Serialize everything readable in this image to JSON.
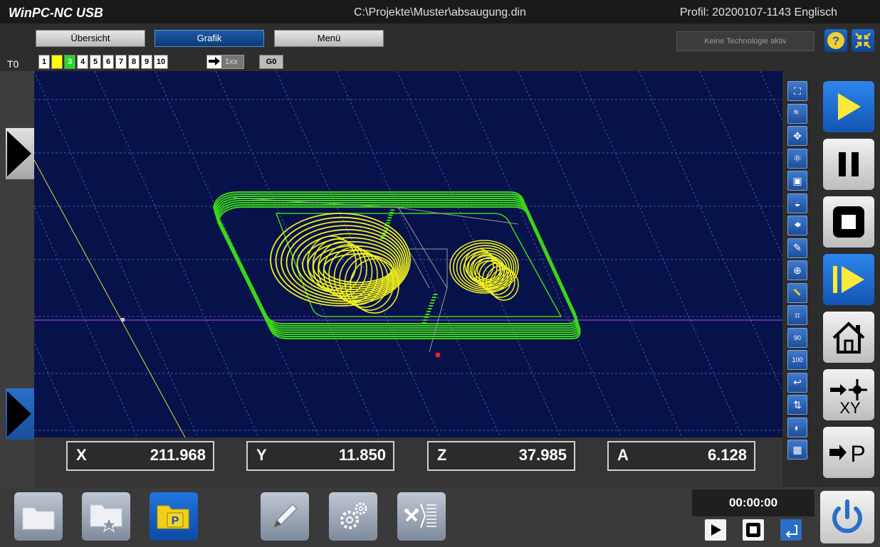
{
  "title_bar": {
    "app_title": "WinPC-NC USB",
    "file_path": "C:\\Projekte\\Muster\\absaugung.din",
    "profile": "Profil: 20200107-1143 Englisch"
  },
  "tabs": [
    {
      "label": "Übersicht",
      "active": false
    },
    {
      "label": "Grafik",
      "active": true
    },
    {
      "label": "Menü",
      "active": false
    }
  ],
  "technology_status": "Keine Technologie aktiv",
  "tools": {
    "current_tool": "T0",
    "tool_numbers": [
      "1",
      "2",
      "3",
      "4",
      "5",
      "6",
      "7",
      "8",
      "9",
      "10"
    ],
    "highlighted": {
      "2": "#ffff00",
      "3": "#22dd22"
    },
    "mode_1xx": "1xx",
    "mode_g0": "G0"
  },
  "coordinates": [
    {
      "axis": "X",
      "value": "211.968"
    },
    {
      "axis": "Y",
      "value": "11.850"
    },
    {
      "axis": "Z",
      "value": "37.985"
    },
    {
      "axis": "A",
      "value": "6.128"
    }
  ],
  "timer": "00:00:00",
  "small_tools": [
    {
      "name": "zoom-fit-icon",
      "glyph": "⛶"
    },
    {
      "name": "zoom-icon",
      "glyph": "🔍"
    },
    {
      "name": "pan-icon",
      "glyph": "✥"
    },
    {
      "name": "atom-icon",
      "glyph": "⚛"
    },
    {
      "name": "cube-view-icon",
      "glyph": "▣"
    },
    {
      "name": "glasses-icon",
      "glyph": "◒"
    },
    {
      "name": "back-arrow-icon",
      "glyph": "🡄"
    },
    {
      "name": "pin-icon",
      "glyph": "✎"
    },
    {
      "name": "move-crosshair-icon",
      "glyph": "⊕"
    },
    {
      "name": "ruler-icon",
      "glyph": "📏"
    },
    {
      "name": "frame-icon",
      "glyph": "⌗"
    },
    {
      "name": "rotate-90-icon",
      "glyph": "90"
    },
    {
      "name": "move-100-icon",
      "glyph": "100"
    },
    {
      "name": "return-icon",
      "glyph": "↩"
    },
    {
      "name": "swap-arrows-icon",
      "glyph": "⇅"
    },
    {
      "name": "contrast-icon",
      "glyph": "◐"
    },
    {
      "name": "grid-icon",
      "glyph": "▦"
    }
  ],
  "big_tools": [
    {
      "name": "start-button",
      "kind": "play"
    },
    {
      "name": "pause-button",
      "kind": "pause"
    },
    {
      "name": "stop-button",
      "kind": "stop"
    },
    {
      "name": "step-forward-button",
      "kind": "step"
    },
    {
      "name": "home-button",
      "kind": "home"
    },
    {
      "name": "go-to-xy-button",
      "kind": "xy",
      "label": "XY"
    },
    {
      "name": "go-to-park-button",
      "kind": "park",
      "label": "P"
    }
  ],
  "bottom_buttons": [
    {
      "name": "open-file-button",
      "kind": "folder"
    },
    {
      "name": "favorites-button",
      "kind": "folder-star"
    },
    {
      "name": "project-button",
      "kind": "folder-p",
      "label": "P"
    },
    {
      "name": "edit-button",
      "kind": "pencil"
    },
    {
      "name": "settings-button",
      "kind": "gears"
    },
    {
      "name": "tools-setup-button",
      "kind": "tools"
    }
  ],
  "colors": {
    "canvas_bg": "#08124a",
    "path_green": "#39d618",
    "path_yellow": "#f0f020",
    "accent_blue": "#1f6ed0"
  }
}
